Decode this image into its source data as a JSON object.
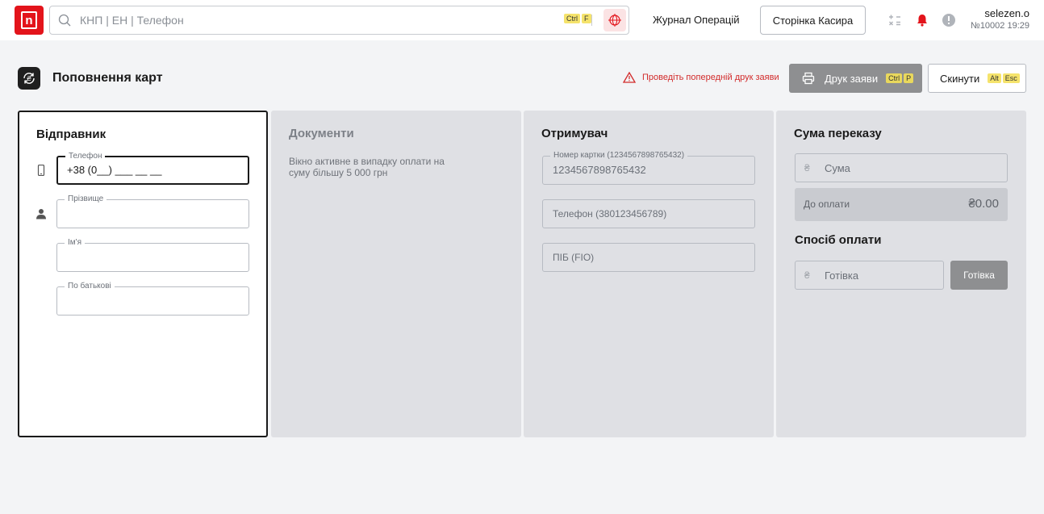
{
  "topbar": {
    "logo_letter": "n",
    "search_placeholder": "КНП | ЕН | Телефон",
    "search_kbd_1": "Ctrl",
    "search_kbd_2": "F",
    "journal_link": "Журнал Операцій",
    "cashier_button": "Сторінка Касира",
    "user_name": "selezen.o",
    "user_meta": "№10002 19:29"
  },
  "page": {
    "title": "Поповнення карт",
    "warning": "Проведіть попередній друк заяви",
    "print_button": "Друк заяви",
    "print_kbd_1": "Ctrl",
    "print_kbd_2": "P",
    "reset_button": "Скинути",
    "reset_kbd_1": "Alt",
    "reset_kbd_2": "Esc"
  },
  "sender": {
    "title": "Відправник",
    "phone_label": "Телефон",
    "phone_value": "+38 (0__) ___ __ __",
    "surname_label": "Прізвище",
    "name_label": "Ім'я",
    "patronymic_label": "По батькові"
  },
  "documents": {
    "title": "Документи",
    "note": "Вікно активне в випадку оплати на суму більшу 5 000 грн"
  },
  "receiver": {
    "title": "Отримувач",
    "card_label": "Номер картки (1234567898765432)",
    "card_value": "1234567898765432",
    "phone_placeholder": "Телефон (380123456789)",
    "fio_placeholder": "ПІБ (FIO)"
  },
  "sum": {
    "title": "Сума переказу",
    "currency_symbol": "₴",
    "amount_placeholder": "Сума",
    "to_pay_label": "До оплати",
    "to_pay_value": "₴0.00",
    "payment_title": "Спосіб оплати",
    "payment_value": "Готівка",
    "payment_button": "Готівка"
  },
  "colors": {
    "brand": "#e3141b",
    "warning": "#d22b2b",
    "disabled_button": "#8e8f91",
    "panel_bg": "#dfe0e4"
  }
}
